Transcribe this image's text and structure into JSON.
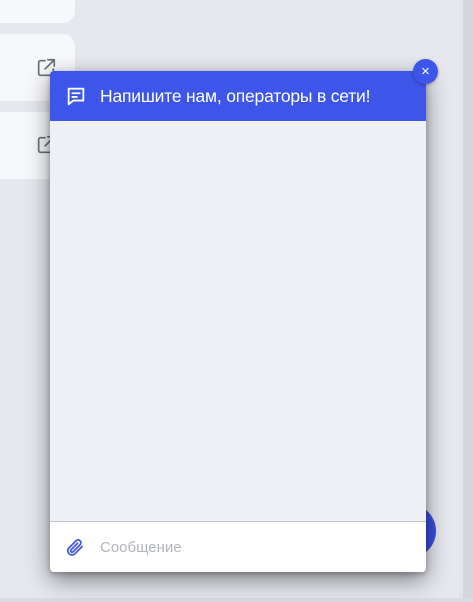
{
  "background": {
    "cards": [
      {
        "icon": "external-link-icon"
      },
      {
        "icon": "external-link-icon"
      }
    ]
  },
  "chat": {
    "header_title": "Напишите нам, операторы в сети!",
    "header_icon": "chat-icon",
    "close_label": "×",
    "message_placeholder": "Сообщение",
    "attach_icon": "paperclip-icon",
    "accent_color": "#3d55e8"
  }
}
